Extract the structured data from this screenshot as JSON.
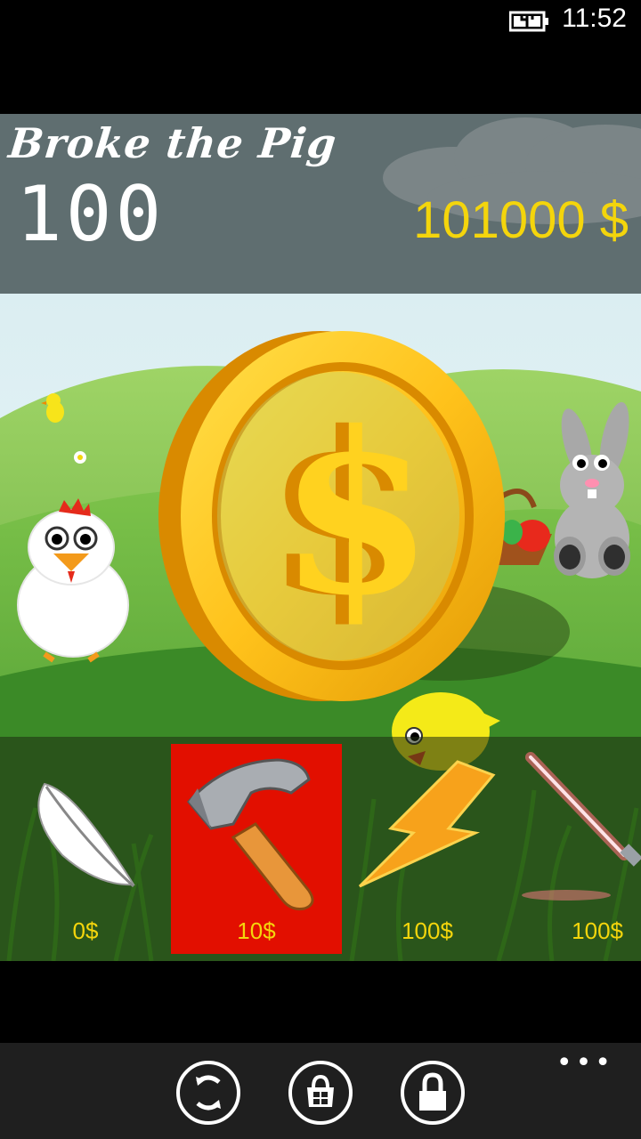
{
  "status": {
    "time": "11:52",
    "battery_icon": "battery-charging-icon"
  },
  "game": {
    "title": "Broke the Pig",
    "score": "100",
    "money": "101000 $"
  },
  "shop": {
    "items": [
      {
        "name": "feather",
        "price": "0$",
        "icon": "feather-icon",
        "selected": false
      },
      {
        "name": "hammer",
        "price": "10$",
        "icon": "hammer-icon",
        "selected": true
      },
      {
        "name": "lightning",
        "price": "100$",
        "icon": "lightning-icon",
        "selected": false
      },
      {
        "name": "lightsaber",
        "price": "100$",
        "icon": "lightsaber-icon",
        "selected": false
      }
    ],
    "selected_color": "#e20f00",
    "price_color": "#f4d50c"
  },
  "appbar": {
    "buttons": [
      {
        "icon": "refresh-icon"
      },
      {
        "icon": "store-icon"
      },
      {
        "icon": "lock-icon"
      }
    ],
    "more_label": "•••"
  }
}
